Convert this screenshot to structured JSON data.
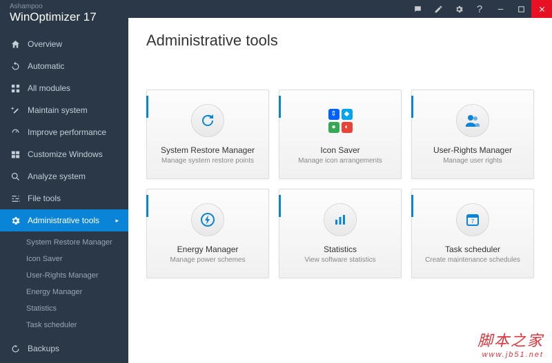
{
  "brand": {
    "small": "Ashampoo",
    "name": "WinOptimizer",
    "version": "17"
  },
  "titlebar_icons": [
    "chat-icon",
    "note-icon",
    "gear-icon",
    "help-icon",
    "minimize-icon",
    "maximize-icon",
    "close-icon"
  ],
  "nav": [
    {
      "label": "Overview",
      "icon": "home-icon"
    },
    {
      "label": "Automatic",
      "icon": "refresh-icon"
    },
    {
      "label": "All modules",
      "icon": "grid-icon"
    },
    {
      "label": "Maintain system",
      "icon": "wand-icon"
    },
    {
      "label": "Improve performance",
      "icon": "gauge-icon"
    },
    {
      "label": "Customize Windows",
      "icon": "windows-icon"
    },
    {
      "label": "Analyze system",
      "icon": "search-icon"
    },
    {
      "label": "File tools",
      "icon": "sliders-icon"
    },
    {
      "label": "Administrative tools",
      "icon": "gear-icon",
      "active": true,
      "chev": "▸"
    },
    {
      "label": "Backups",
      "icon": "backup-icon"
    }
  ],
  "subnav": [
    {
      "label": "System Restore Manager"
    },
    {
      "label": "Icon Saver"
    },
    {
      "label": "User-Rights Manager"
    },
    {
      "label": "Energy Manager"
    },
    {
      "label": "Statistics"
    },
    {
      "label": "Task scheduler"
    }
  ],
  "page": {
    "title": "Administrative tools"
  },
  "cards": [
    {
      "title": "System Restore Manager",
      "desc": "Manage system restore points",
      "icon": "restore-icon"
    },
    {
      "title": "Icon Saver",
      "desc": "Manage icon arrangements",
      "icon": "icon-saver-icon"
    },
    {
      "title": "User-Rights Manager",
      "desc": "Manage user rights",
      "icon": "users-icon"
    },
    {
      "title": "Energy Manager",
      "desc": "Manage power schemes",
      "icon": "power-icon"
    },
    {
      "title": "Statistics",
      "desc": "View software statistics",
      "icon": "stats-icon"
    },
    {
      "title": "Task scheduler",
      "desc": "Create maintenance schedules",
      "icon": "calendar-icon"
    }
  ],
  "watermark": {
    "line1": "脚本之家",
    "line2": "www.jb51.net"
  }
}
